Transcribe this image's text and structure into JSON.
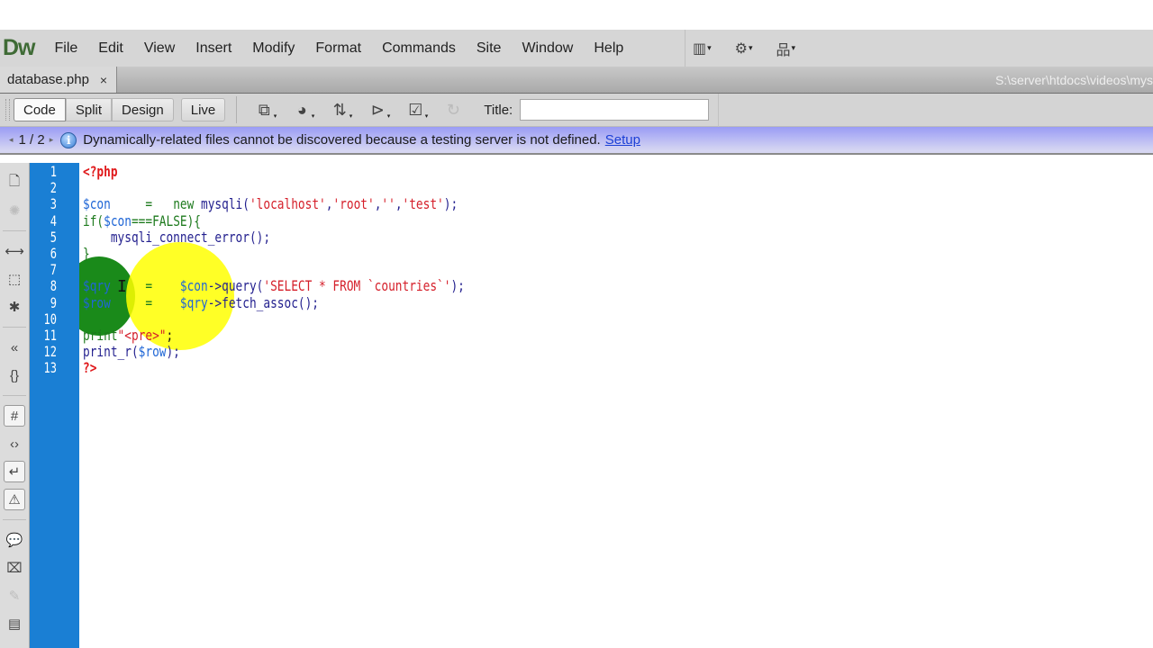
{
  "app": {
    "logo": "Dw",
    "menu": [
      "File",
      "Edit",
      "View",
      "Insert",
      "Modify",
      "Format",
      "Commands",
      "Site",
      "Window",
      "Help"
    ],
    "menu_icons": [
      {
        "name": "layout-icon",
        "glyph": "▥"
      },
      {
        "name": "gear-icon",
        "glyph": "⚙"
      },
      {
        "name": "site-map-icon",
        "glyph": "品"
      }
    ],
    "caret": "▾"
  },
  "document_tab": {
    "filename": "database.php",
    "close_glyph": "×",
    "path": "S:\\server\\htdocs\\videos\\mys"
  },
  "toolbar": {
    "views": [
      "Code",
      "Split",
      "Design"
    ],
    "live": "Live",
    "active_view": "Code",
    "icons": [
      {
        "name": "multiscreen-icon",
        "glyph": "⧉"
      },
      {
        "name": "preview-browser-icon",
        "glyph": "◕"
      },
      {
        "name": "file-management-icon",
        "glyph": "⇅"
      },
      {
        "name": "inspect-icon",
        "glyph": "⊳"
      },
      {
        "name": "validate-icon",
        "glyph": "☑"
      },
      {
        "name": "refresh-icon",
        "glyph": "↻"
      }
    ],
    "title_label": "Title:",
    "title_value": ""
  },
  "infobar": {
    "prev": "◂",
    "next": "▸",
    "pager": "1 / 2",
    "info_glyph": "i",
    "message": "Dynamically-related files cannot be discovered because a testing server is not defined.",
    "link": "Setup"
  },
  "side_toolbar": {
    "icons": [
      {
        "name": "open-documents-icon",
        "glyph": "🗋",
        "disabled": false
      },
      {
        "name": "show-code-navigator-icon",
        "glyph": "✺",
        "disabled": true
      },
      {
        "sep": true
      },
      {
        "name": "collapse-full-tag-icon",
        "glyph": "⟷",
        "disabled": false
      },
      {
        "name": "collapse-selection-icon",
        "glyph": "⬚",
        "disabled": false
      },
      {
        "name": "expand-all-icon",
        "glyph": "✱",
        "disabled": false
      },
      {
        "sep": true
      },
      {
        "name": "select-parent-tag-icon",
        "glyph": "«",
        "disabled": false
      },
      {
        "name": "balance-braces-icon",
        "glyph": "{}",
        "disabled": false
      },
      {
        "sep": true
      },
      {
        "name": "line-numbers-icon",
        "glyph": "#",
        "disabled": false,
        "boxed": true
      },
      {
        "name": "highlight-invalid-code-icon",
        "glyph": "‹›",
        "disabled": false
      },
      {
        "name": "word-wrap-icon",
        "glyph": "↵",
        "disabled": false,
        "boxed": true
      },
      {
        "name": "syntax-error-alerts-icon",
        "glyph": "⚠",
        "disabled": false,
        "boxed": true
      },
      {
        "sep": true
      },
      {
        "name": "apply-comment-icon",
        "glyph": "💬",
        "disabled": false
      },
      {
        "name": "remove-comment-icon",
        "glyph": "⌧",
        "disabled": false
      },
      {
        "name": "wrap-tag-icon",
        "glyph": "✎",
        "disabled": true
      },
      {
        "name": "recent-snippets-icon",
        "glyph": "▤",
        "disabled": false
      }
    ]
  },
  "editor": {
    "line_numbers": [
      "1",
      "2",
      "3",
      "4",
      "5",
      "6",
      "7",
      "8",
      "9",
      "10",
      "11",
      "12",
      "13"
    ],
    "lines": [
      [
        {
          "t": "<?php",
          "c": "tag"
        }
      ],
      [],
      [
        {
          "t": "$con",
          "c": "var"
        },
        {
          "t": "     =   ",
          "c": "op"
        },
        {
          "t": "new",
          "c": "kw"
        },
        {
          "t": " mysqli(",
          "c": "fn"
        },
        {
          "t": "'localhost'",
          "c": "str"
        },
        {
          "t": ",",
          "c": "fn"
        },
        {
          "t": "'root'",
          "c": "str"
        },
        {
          "t": ",",
          "c": "fn"
        },
        {
          "t": "''",
          "c": "str"
        },
        {
          "t": ",",
          "c": "fn"
        },
        {
          "t": "'test'",
          "c": "str"
        },
        {
          "t": ");",
          "c": "fn"
        }
      ],
      [
        {
          "t": "if(",
          "c": "kw"
        },
        {
          "t": "$con",
          "c": "var"
        },
        {
          "t": "===FALSE){",
          "c": "kw"
        }
      ],
      [
        {
          "t": "    mysqli_connect_error();",
          "c": "fn"
        }
      ],
      [
        {
          "t": "}",
          "c": "kw"
        }
      ],
      [],
      [
        {
          "t": "$qry",
          "c": "var"
        },
        {
          "t": "     =    ",
          "c": "op"
        },
        {
          "t": "$con",
          "c": "var"
        },
        {
          "t": "->query(",
          "c": "fn"
        },
        {
          "t": "'SELECT * FROM `countries`'",
          "c": "str"
        },
        {
          "t": ");",
          "c": "fn"
        }
      ],
      [
        {
          "t": "$row",
          "c": "var"
        },
        {
          "t": "     =    ",
          "c": "op"
        },
        {
          "t": "$qry",
          "c": "var"
        },
        {
          "t": "->fetch_assoc();",
          "c": "fn"
        }
      ],
      [],
      [
        {
          "t": "print",
          "c": "kw"
        },
        {
          "t": "\"<pre>\"",
          "c": "str"
        },
        {
          "t": ";",
          "c": "pl"
        }
      ],
      [
        {
          "t": "print_r(",
          "c": "fn"
        },
        {
          "t": "$row",
          "c": "var"
        },
        {
          "t": ");",
          "c": "fn"
        }
      ],
      [
        {
          "t": "?>",
          "c": "tag"
        }
      ]
    ],
    "text_cursor": "I"
  }
}
